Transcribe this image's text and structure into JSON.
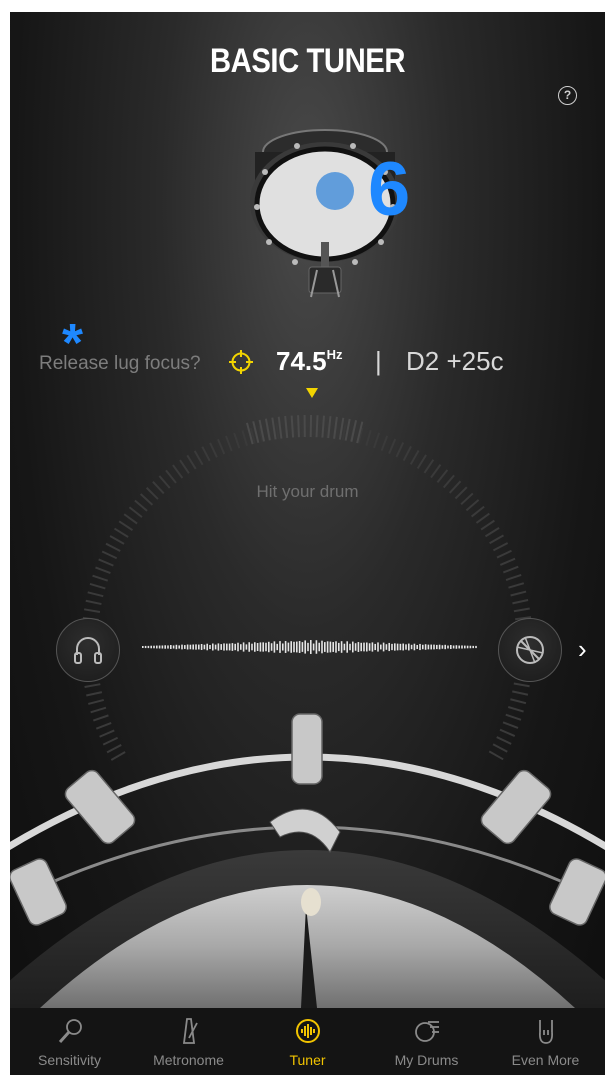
{
  "header": {
    "title": "BASIC TUNER",
    "help_icon": "help-circle-icon",
    "help_glyph": "?"
  },
  "overlay": {
    "marker_number": "6",
    "marker_asterisk": "*"
  },
  "tuner": {
    "release_label": "Release lug focus?",
    "frequency": "74.5",
    "frequency_unit": "Hz",
    "separator": "|",
    "note": "D2 +25c",
    "hint": "Hit your drum",
    "accent_color": "#f2d400"
  },
  "controls": {
    "next_glyph": "›"
  },
  "tabs": [
    {
      "label": "Sensitivity",
      "icon": "microphone-icon",
      "active": false
    },
    {
      "label": "Metronome",
      "icon": "metronome-icon",
      "active": false
    },
    {
      "label": "Tuner",
      "icon": "tuner-drum-icon",
      "active": true
    },
    {
      "label": "My Drums",
      "icon": "drum-list-icon",
      "active": false
    },
    {
      "label": "Even More",
      "icon": "rock-hand-icon",
      "active": false
    }
  ]
}
